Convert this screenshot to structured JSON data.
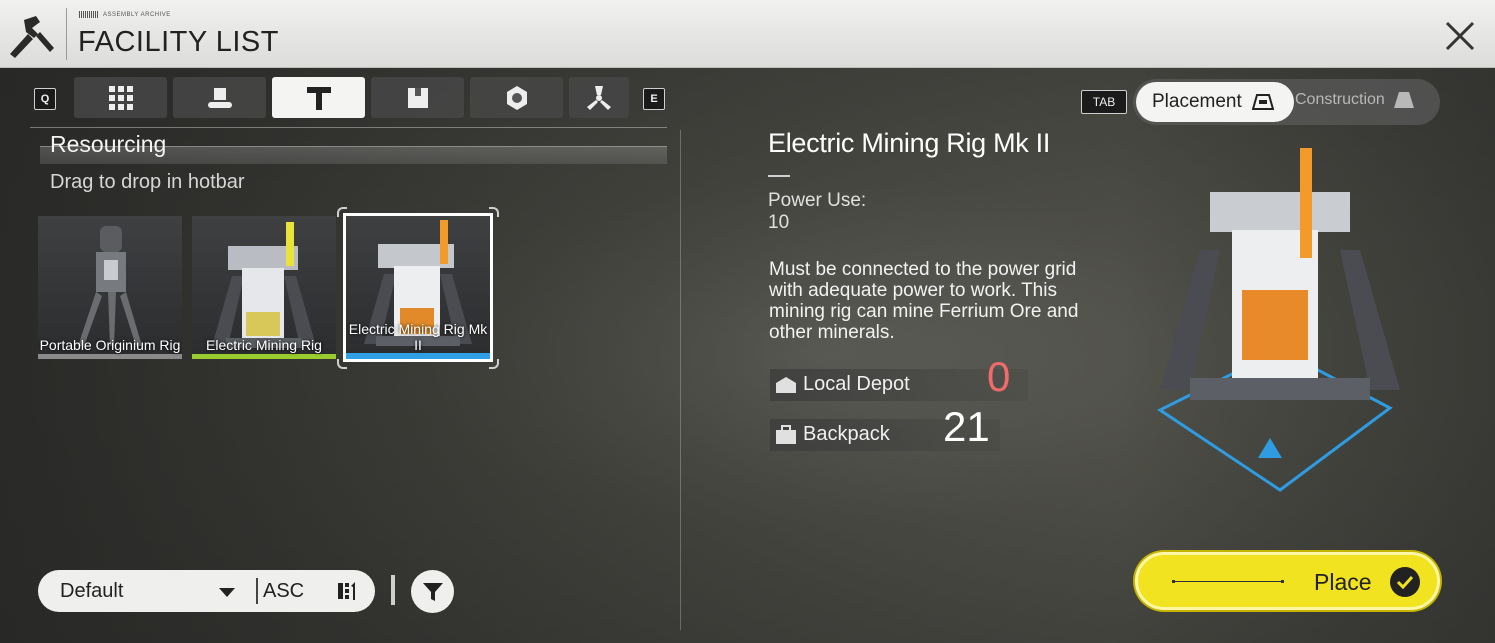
{
  "header": {
    "small_label": "ASSEMBLY ARCHIVE",
    "title": "FACILITY LIST",
    "close_icon": "close-icon"
  },
  "tabs": {
    "left_key": "Q",
    "right_key": "E",
    "items": [
      {
        "icon": "grid-icon"
      },
      {
        "icon": "conveyor-icon"
      },
      {
        "icon": "hammer-icon",
        "active": true
      },
      {
        "icon": "storage-icon"
      },
      {
        "icon": "gear-icon"
      },
      {
        "icon": "fan-icon"
      }
    ]
  },
  "section": {
    "title": "Resourcing",
    "subtitle": "Drag to drop in hotbar"
  },
  "items": [
    {
      "label": "Portable Originium Rig",
      "bar_color": "#8a8a8a"
    },
    {
      "label": "Electric Mining Rig",
      "bar_color": "#9acb2f"
    },
    {
      "label": "Electric Mining Rig Mk II",
      "bar_color": "#2fa0e6",
      "selected": true
    }
  ],
  "sort": {
    "field": "Default",
    "order": "ASC"
  },
  "mode": {
    "key": "TAB",
    "active": "Placement",
    "inactive": "Construction"
  },
  "detail": {
    "title": "Electric Mining Rig Mk II",
    "power_label": "Power Use:",
    "power_value": "10",
    "description": "Must be connected to the power grid with adequate power to work. This mining rig can mine Ferrium Ore and other minerals.",
    "local_depot_label": "Local Depot",
    "local_depot_value": "0",
    "backpack_label": "Backpack",
    "backpack_value": "21"
  },
  "action": {
    "place_label": "Place"
  },
  "colors": {
    "accent_yellow": "#f2e320",
    "depot_zero": "#f26b6b",
    "selected_blue": "#2fa0e6"
  }
}
